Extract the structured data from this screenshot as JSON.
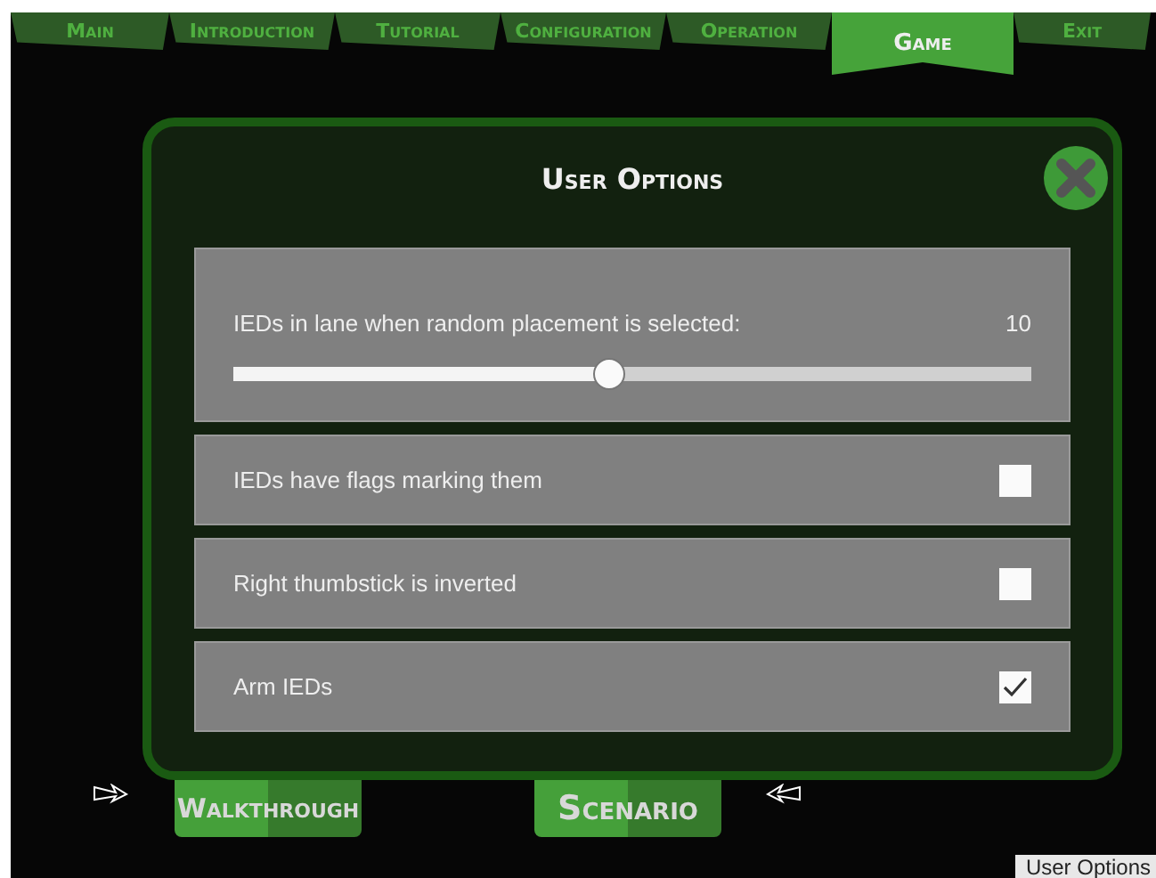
{
  "tabs": [
    {
      "label": "Main",
      "selected": false
    },
    {
      "label": "Introduction",
      "selected": false
    },
    {
      "label": "Tutorial",
      "selected": false
    },
    {
      "label": "Configuration",
      "selected": false
    },
    {
      "label": "Operation",
      "selected": false
    },
    {
      "label": "Game",
      "selected": true
    },
    {
      "label": "Exit",
      "selected": false
    }
  ],
  "dialog": {
    "title": "User Options",
    "options": [
      {
        "kind": "slider",
        "label": "IEDs in lane when random placement is selected:",
        "reading": "10",
        "level": 0.47
      },
      {
        "kind": "checkbox",
        "label": "IEDs have flags marking them",
        "checked": false
      },
      {
        "kind": "checkbox",
        "label": "Right thumbstick is inverted",
        "checked": false
      },
      {
        "kind": "checkbox",
        "label": "Arm IEDs",
        "checked": true
      }
    ]
  },
  "buttons": [
    "Walkthrough",
    "Scenario"
  ],
  "status_label": "User Options"
}
